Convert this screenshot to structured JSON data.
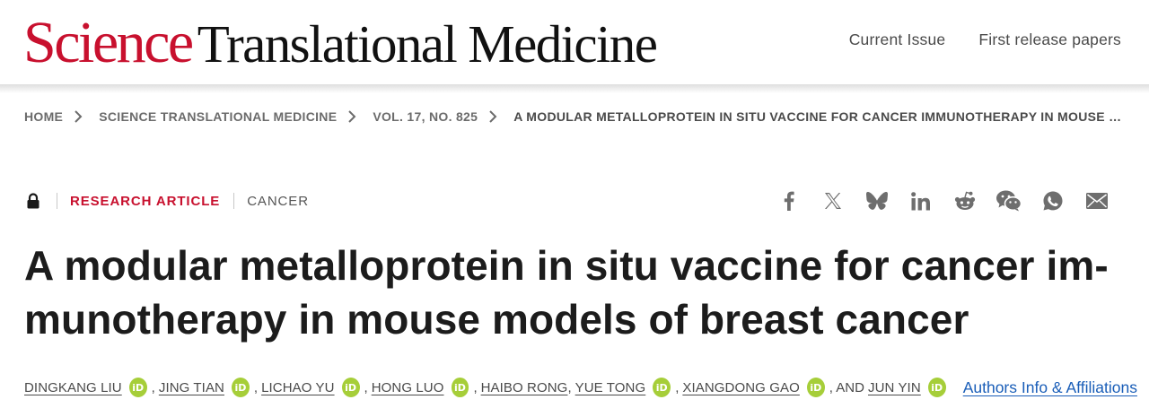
{
  "header": {
    "logo_science": "Science",
    "logo_rest": "Translational Medicine",
    "nav": [
      "Current Issue",
      "First release papers"
    ]
  },
  "breadcrumb": {
    "items": [
      "HOME",
      "SCIENCE TRANSLATIONAL MEDICINE",
      "VOL. 17, NO. 825"
    ],
    "current": "A MODULAR METALLOPROTEIN IN SITU VACCINE FOR CANCER IMMUNOTHERAPY IN MOUSE MODELS OF BREAST CANCER"
  },
  "meta": {
    "access_icon": "lock-icon",
    "article_type": "RESEARCH ARTICLE",
    "subject": "CANCER"
  },
  "share_icons": [
    "facebook-icon",
    "x-icon",
    "bluesky-icon",
    "linkedin-icon",
    "reddit-icon",
    "wechat-icon",
    "whatsapp-icon",
    "email-icon"
  ],
  "article": {
    "title": "A modular metalloprotein in situ vaccine for cancer im-munotherapy in mouse models of breast cancer"
  },
  "authors": {
    "list": [
      {
        "name": "DINGKANG LIU",
        "orcid": true,
        "after": ","
      },
      {
        "name": "JING TIAN",
        "orcid": true,
        "after": ","
      },
      {
        "name": "LICHAO YU",
        "orcid": true,
        "after": ","
      },
      {
        "name": "HONG LUO",
        "orcid": true,
        "after": ","
      },
      {
        "name": "HAIBO RONG",
        "orcid": false,
        "after": ","
      },
      {
        "name": "YUE TONG",
        "orcid": true,
        "after": ","
      },
      {
        "name": "XIANGDONG GAO",
        "orcid": true,
        "after": ", AND"
      },
      {
        "name": "JUN YIN",
        "orcid": true,
        "after": ""
      }
    ],
    "orcid_label": "iD",
    "affiliations_link": "Authors Info & Affiliations"
  },
  "colors": {
    "brand_red": "#c8102e",
    "orcid_green": "#a6ce39",
    "link_blue": "#1a5eb8"
  }
}
